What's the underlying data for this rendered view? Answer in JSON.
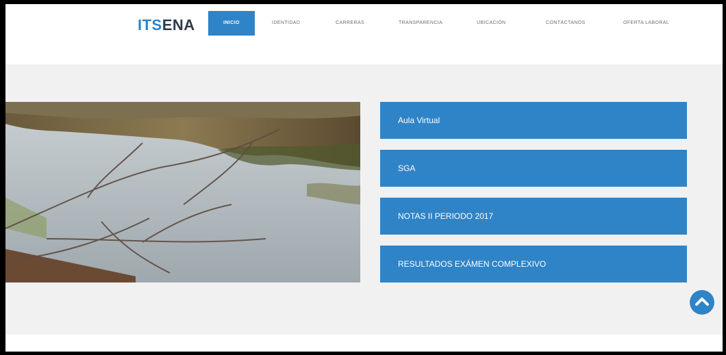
{
  "logo": {
    "part1": "ITS",
    "part2": "ENA"
  },
  "nav": {
    "items": [
      {
        "label": "INICIO",
        "active": true
      },
      {
        "label": "IDENTIDAD"
      },
      {
        "label": "CARRERAS"
      },
      {
        "label": "TRANSPARENCIA"
      },
      {
        "label": "UBICACIÓN"
      },
      {
        "label": "CONTÁCTANOS"
      },
      {
        "label": "OFERTA LABORAL"
      }
    ]
  },
  "links": [
    {
      "label": "Aula Virtual"
    },
    {
      "label": "SGA"
    },
    {
      "label": "NOTAS II PERIODO 2017"
    },
    {
      "label": "RESULTADOS EXÁMEN COMPLEXIVO"
    }
  ],
  "colors": {
    "accent": "#2f84c8",
    "background": "#f1f1f1"
  },
  "icons": {
    "scroll_top": "chevron-up-circle-icon"
  }
}
